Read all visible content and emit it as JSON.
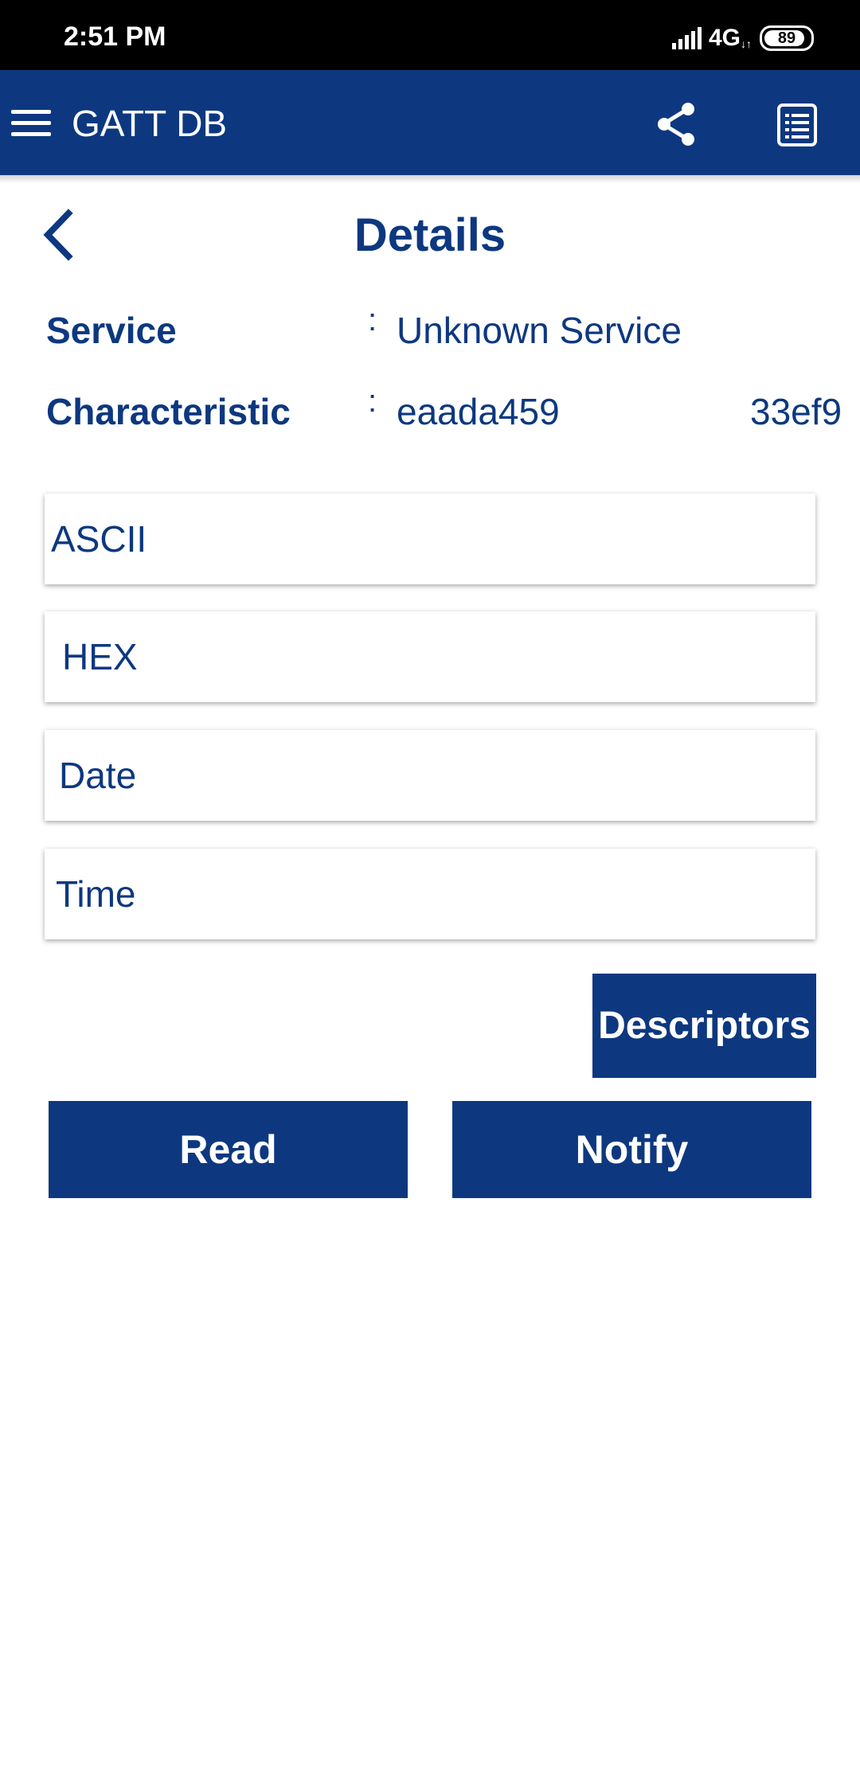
{
  "status_bar": {
    "time": "2:51 PM",
    "network": "4G",
    "network_sub": "↓↑",
    "battery_level": "89"
  },
  "app_bar": {
    "title": "GATT DB",
    "icons": [
      "menu-icon",
      "share-icon",
      "list-icon"
    ]
  },
  "details": {
    "title": "Details",
    "back_icon": "chevron-left-icon",
    "separator": ":",
    "service": {
      "label": "Service",
      "value": "Unknown Service"
    },
    "characteristic": {
      "label": "Characteristic",
      "value_part1": "eaada459",
      "value_part2": "33ef9"
    }
  },
  "fields": {
    "ascii": "ASCII",
    "hex": "HEX",
    "date": "Date",
    "time": "Time"
  },
  "buttons": {
    "descriptors": "Descriptors",
    "read": "Read",
    "notify": "Notify"
  },
  "colors": {
    "primary": "#0d3880",
    "status_bar": "#000000",
    "background": "#ffffff"
  }
}
